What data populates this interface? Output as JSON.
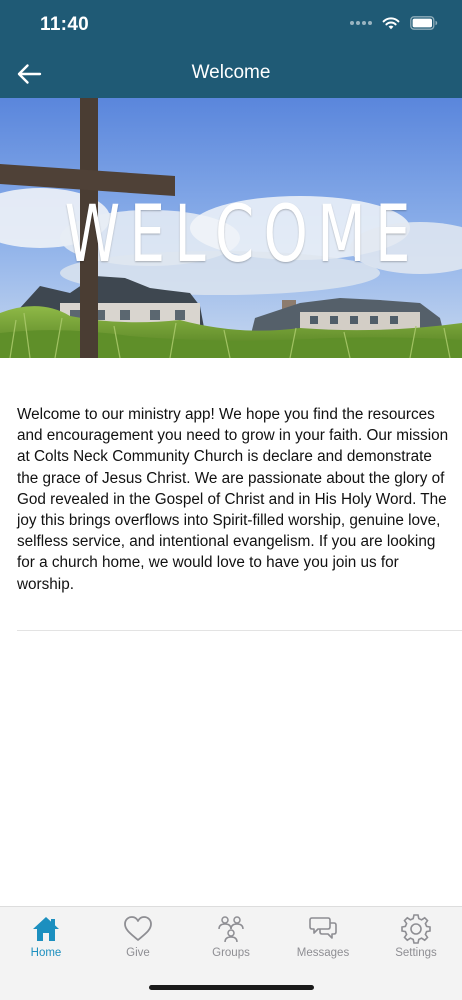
{
  "status_bar": {
    "time": "11:40"
  },
  "header": {
    "title": "Welcome",
    "back_icon": "arrow-left-icon"
  },
  "banner": {
    "text": "WELCOME"
  },
  "content": {
    "paragraph": "Welcome to our ministry app! We hope you find the resources and encouragement you need to grow in your faith. Our mission at Colts Neck Community Church is declare and demonstrate the grace of Jesus Christ. We are passionate about the glory of God revealed in the Gospel of Christ and in His Holy Word. The joy this brings overflows into Spirit-filled worship, genuine love, selfless service, and intentional evangelism. If you are looking for a church home, we would love to have you join us for worship."
  },
  "tabs": [
    {
      "label": "Home",
      "icon": "home-icon",
      "active": true
    },
    {
      "label": "Give",
      "icon": "heart-icon",
      "active": false
    },
    {
      "label": "Groups",
      "icon": "groups-icon",
      "active": false
    },
    {
      "label": "Messages",
      "icon": "messages-icon",
      "active": false
    },
    {
      "label": "Settings",
      "icon": "gear-icon",
      "active": false
    }
  ],
  "colors": {
    "header": "#1f5a75",
    "accent": "#1c8fbf",
    "inactive": "#8e8e93"
  }
}
